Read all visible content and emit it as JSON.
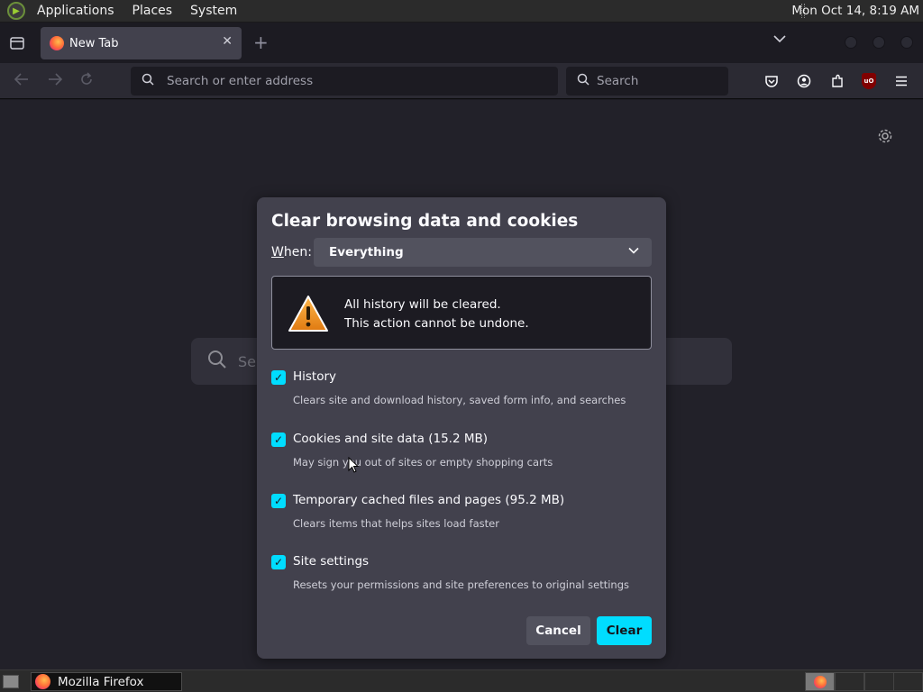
{
  "top_panel": {
    "menus": [
      "Applications",
      "Places",
      "System"
    ],
    "clock": "Mon Oct 14,  8:19 AM"
  },
  "tabbar": {
    "tab_title": "New Tab",
    "new_tab_glyph": "+",
    "close_glyph": "✕"
  },
  "navbar": {
    "url_placeholder": "Search or enter address",
    "search_placeholder": "Search",
    "ublock_badge": "uO"
  },
  "page": {
    "search_placeholder": "Se"
  },
  "dialog": {
    "title": "Clear browsing data and cookies",
    "when_label_accesskey": "W",
    "when_label_rest": "hen:",
    "when_value": "Everything",
    "warning_line1": "All history will be cleared.",
    "warning_line2": "This action cannot be undone.",
    "options": [
      {
        "label": "History",
        "description": "Clears site and download history, saved form info, and searches",
        "checked": true
      },
      {
        "label": "Cookies and site data (15.2 MB)",
        "description": "May sign you out of sites or empty shopping carts",
        "checked": true
      },
      {
        "label": "Temporary cached files and pages (95.2 MB)",
        "description": "Clears items that helps sites load faster",
        "checked": true
      },
      {
        "label": "Site settings",
        "description": "Resets your permissions and site preferences to original settings",
        "checked": true
      }
    ],
    "cancel_label": "Cancel",
    "clear_label": "Clear"
  },
  "taskbar": {
    "window_title": "Mozilla Firefox"
  },
  "colors": {
    "accent": "#00ddff",
    "dialog_bg": "#42414d",
    "page_bg": "#2b2a33"
  }
}
